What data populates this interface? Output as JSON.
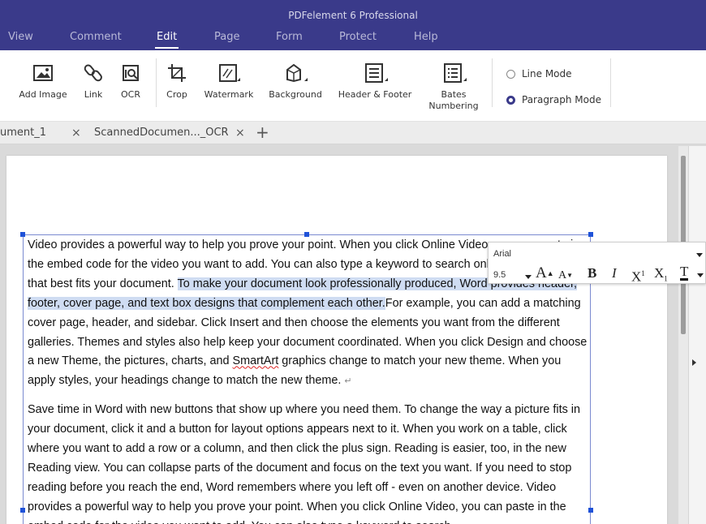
{
  "app": {
    "title": "PDFelement 6 Professional"
  },
  "menu": [
    {
      "label": "View",
      "active": false
    },
    {
      "label": "Comment",
      "active": false
    },
    {
      "label": "Edit",
      "active": true
    },
    {
      "label": "Page",
      "active": false
    },
    {
      "label": "Form",
      "active": false
    },
    {
      "label": "Protect",
      "active": false
    },
    {
      "label": "Help",
      "active": false
    }
  ],
  "ribbon": {
    "buttons": [
      {
        "label": "Add Image",
        "icon": "image-icon"
      },
      {
        "label": "Link",
        "icon": "link-icon"
      },
      {
        "label": "OCR",
        "icon": "ocr-icon"
      },
      {
        "label": "Crop",
        "icon": "crop-icon"
      },
      {
        "label": "Watermark",
        "icon": "watermark-icon"
      },
      {
        "label": "Background",
        "icon": "background-icon"
      },
      {
        "label": "Header & Footer",
        "icon": "header-footer-icon"
      },
      {
        "label": "Bates Numbering",
        "icon": "bates-numbering-icon"
      }
    ],
    "modes": [
      {
        "label": "Line Mode",
        "selected": false
      },
      {
        "label": "Paragraph Mode",
        "selected": true
      }
    ]
  },
  "tabs": [
    {
      "label": "ument_1",
      "close": "×"
    },
    {
      "label": "ScannedDocumen..._OCR",
      "close": "×"
    }
  ],
  "tab_add": "+",
  "font_toolbar": {
    "font_name": "Arial",
    "font_size": "9.5",
    "buttons": [
      "A",
      "A",
      "B",
      "I",
      "X",
      "X",
      "T"
    ],
    "superscript_mark": "1",
    "subscript_mark": "1"
  },
  "document": {
    "p1_before_highlight": "Video provides a powerful way to help you prove your point. When you click Online Video, you can paste in the embed code for the video you want to add. You can also type a keyword to search online for the video that best fits your document. ",
    "p1_highlight": "To make your document look professionally produced, Word provides header, footer, cover page, and text box designs that complement each other.",
    "p1_after_highlight_a": "For example, you can add a matching cover page, header, and sidebar. Click Insert and then choose the elements you want from the different galleries. Themes and styles also help keep your document coordinated. When you click Design and choose a new Theme, the pictures, charts, and ",
    "p1_smartart": "SmartArt",
    "p1_after_highlight_b": " graphics change to match your new theme. When you apply styles, your headings change to match the new theme.",
    "paragraph_mark": "↵",
    "p2": "Save time in Word with new buttons that show up where you need them. To change the way a picture fits in your document, click it and a button for layout options appears next to it. When you work on a table, click where you want to add a row or a column, and then click the plus sign. Reading is easier, too, in the new Reading view. You can collapse parts of the document and focus on the text you want. If you need to stop reading before you reach the end, Word remembers where you left off - even on another device. Video provides a powerful way to help you prove your point. When you click Online Video, you can paste in the embed code for the video you want to add. You can also type a keyword to search"
  },
  "colors": {
    "title_bar": "#3a3a8a",
    "highlight": "#cfdcf2",
    "handle": "#1f52d8",
    "frame": "#7b8ad0"
  }
}
